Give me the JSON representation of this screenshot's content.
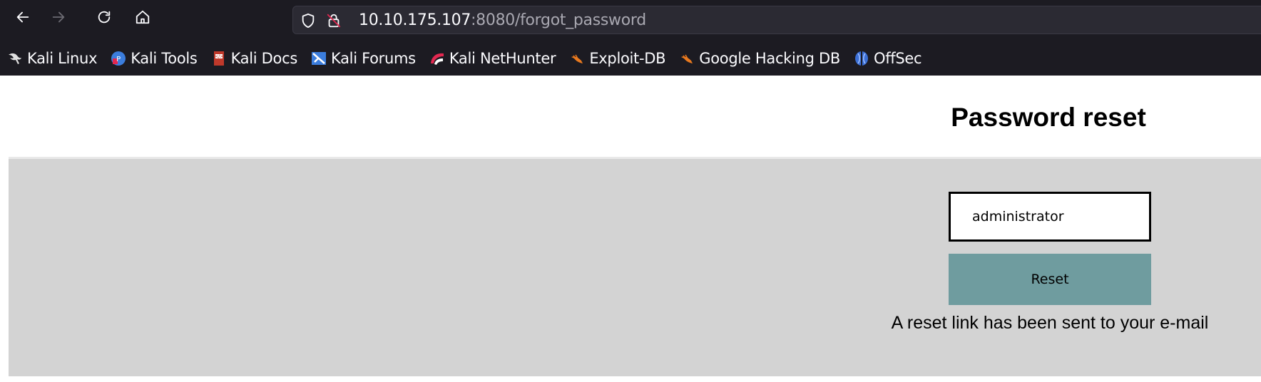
{
  "browser": {
    "nav": {
      "back_icon": "arrow-left-icon",
      "forward_icon": "arrow-right-icon",
      "reload_icon": "reload-icon",
      "home_icon": "home-icon"
    },
    "url": {
      "host": "10.10.175.107",
      "rest": ":8080/forgot_password",
      "shield_icon": "shield-icon",
      "lock_icon": "insecure-lock-icon"
    },
    "bookmarks": [
      {
        "label": "Kali Linux",
        "icon": "kali-dragon-icon"
      },
      {
        "label": "Kali Tools",
        "icon": "kali-tools-icon"
      },
      {
        "label": "Kali Docs",
        "icon": "kali-docs-icon"
      },
      {
        "label": "Kali Forums",
        "icon": "kali-forums-icon"
      },
      {
        "label": "Kali NetHunter",
        "icon": "kali-nethunter-icon"
      },
      {
        "label": "Exploit-DB",
        "icon": "exploit-db-icon"
      },
      {
        "label": "Google Hacking DB",
        "icon": "ghdb-icon"
      },
      {
        "label": "OffSec",
        "icon": "offsec-icon"
      }
    ]
  },
  "page": {
    "title": "Password reset",
    "form": {
      "username_value": "administrator",
      "reset_label": "Reset",
      "status_message": "A reset link has been sent to your e-mail"
    }
  },
  "colors": {
    "chrome_bg": "#1c1b22",
    "urlbar_bg": "#2b2a33",
    "panel_bg": "#d3d3d3",
    "button_bg": "#6f9c9f"
  }
}
